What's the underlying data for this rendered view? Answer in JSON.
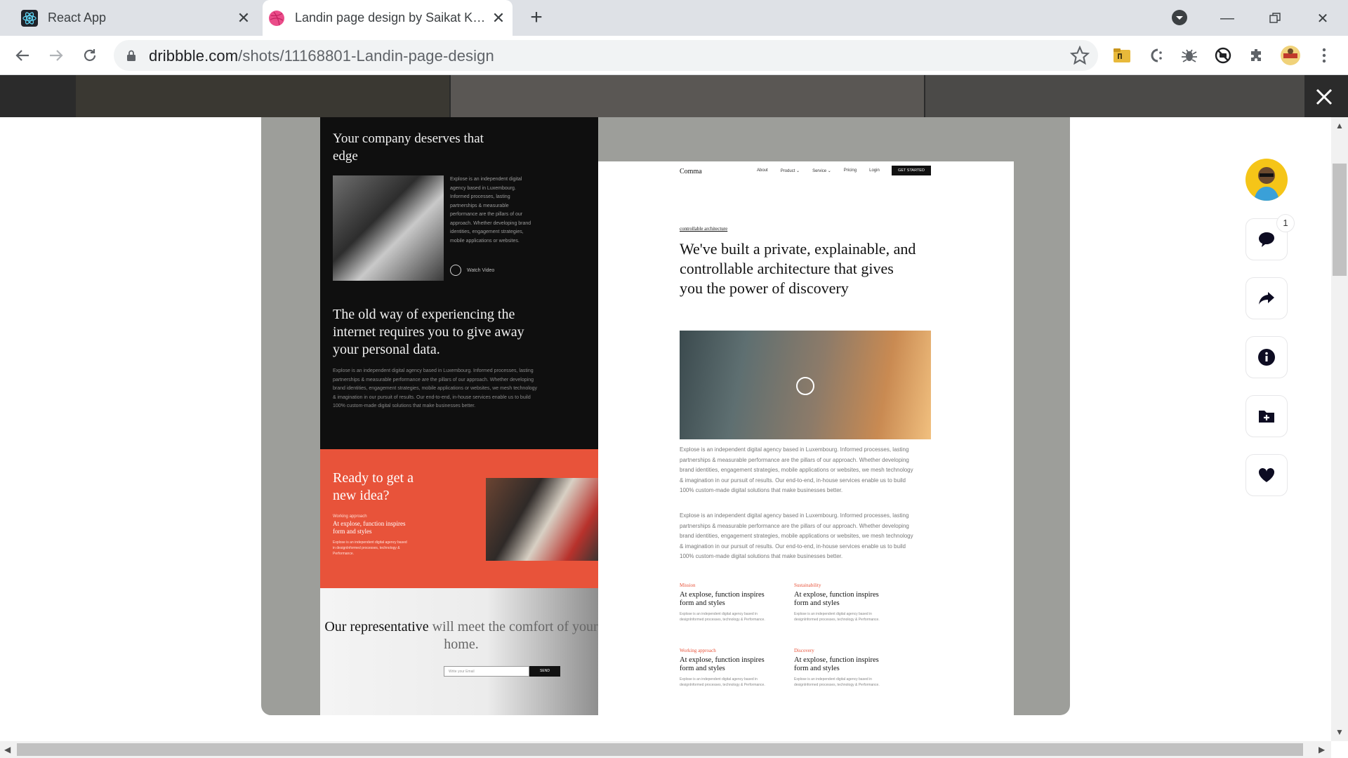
{
  "browser": {
    "tabs": [
      {
        "title": "React App",
        "active": false,
        "icon": "react-icon"
      },
      {
        "title": "Landin page design by Saikat Kumar",
        "active": true,
        "icon": "dribbble-icon"
      }
    ],
    "address": {
      "domain": "dribbble.com",
      "path": "/shots/11168801-Landin-page-design"
    },
    "colors": {
      "tabbar": "#dee1e6",
      "dribbble_pink": "#ea4c89"
    }
  },
  "shot": {
    "dark": {
      "heading": "Your company deserves that edge",
      "side_text": "Explose is an independent digital agency based in Luxembourg. Informed processes, lasting partnerships & measurable performance are the pillars of our approach. Whether developing brand identities, engagement strategies, mobile applications or websites.",
      "watch_label": "Watch Video",
      "heading2": "The old way of experiencing the internet requires you to give away your personal data.",
      "paragraph": "Explose is an independent digital agency based in Luxembourg. Informed processes, lasting partnerships & measurable performance are the pillars of our approach. Whether developing brand identities, engagement strategies, mobile applications or websites, we mesh technology & imagination in our pursuit of results. Our end-to-end, in-house services enable us to build 100% custom-made digital solutions that make businesses better."
    },
    "red": {
      "heading": "Ready to get a new idea?",
      "label": "Working approach",
      "subheading": "At explose, function inspires form and styles",
      "small": "Explose is an independent digital agency based in designInformed processes, technology & Performance."
    },
    "contact": {
      "heading_strong": "Our representative",
      "heading_soft": "will meet the comfort of your home.",
      "email_placeholder": "Write your Email",
      "send_label": "SEND"
    },
    "light": {
      "logo": "Comma",
      "nav": [
        "About",
        "Product ⌄",
        "Service ⌄",
        "Pricing",
        "Login"
      ],
      "cta": "GET STARTED",
      "kicker": "controllable architecture",
      "headline": "We've built a private, explainable, and controllable architecture that gives you the power of discovery",
      "paragraph1": "Explose is an independent digital agency based in Luxembourg. Informed processes, lasting partnerships & measurable performance are the pillars of our approach. Whether developing brand identities, engagement strategies, mobile applications or websites, we mesh technology & imagination in our pursuit of results. Our end-to-end, in-house services enable us to build 100% custom-made digital solutions that make businesses better.",
      "paragraph2": "Explose is an independent digital agency based in Luxembourg. Informed processes, lasting partnerships & measurable performance are the pillars of our approach. Whether developing brand identities, engagement strategies, mobile applications or websites, we mesh technology & imagination in our pursuit of results. Our end-to-end, in-house services enable us to build 100% custom-made digital solutions that make businesses better.",
      "features": [
        {
          "label": "Mission",
          "title": "At explose, function inspires form and styles",
          "text": "Explose is an independent digital agency based in designInformed processes, technology & Performance."
        },
        {
          "label": "Sustainability",
          "title": "At explose, function inspires form and styles",
          "text": "Explose is an independent digital agency based in designInformed processes, technology & Performance."
        },
        {
          "label": "Working approach",
          "title": "At explose, function inspires form and styles",
          "text": "Explose is an independent digital agency based in designInformed processes, technology & Performance."
        },
        {
          "label": "Discovery",
          "title": "At explose, function inspires form and styles",
          "text": "Explose is an independent digital agency based in designInformed processes, technology & Performance."
        }
      ]
    }
  },
  "actions": {
    "comment_count": "1",
    "icons": [
      "comment-icon",
      "share-icon",
      "info-icon",
      "add-to-collection-icon",
      "heart-icon"
    ]
  }
}
